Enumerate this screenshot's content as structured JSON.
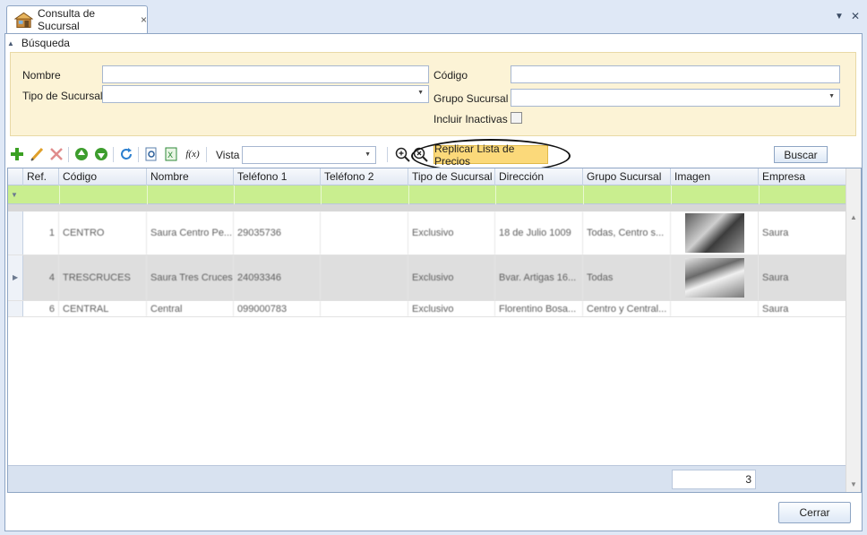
{
  "tab": {
    "title": "Consulta de Sucursal",
    "close_glyph": "×"
  },
  "window_controls": {
    "menu_glyph": "▼",
    "close_glyph": "✕"
  },
  "search": {
    "group_title": "Búsqueda",
    "nombre_label": "Nombre",
    "nombre_value": "",
    "tipo_label": "Tipo de Sucursal",
    "tipo_value": "",
    "codigo_label": "Código",
    "codigo_value": "",
    "grupo_label": "Grupo Sucursal",
    "grupo_value": "",
    "inactivas_label": "Incluir Inactivas",
    "inactivas_checked": false
  },
  "toolbar": {
    "icons": [
      "add-icon",
      "edit-icon",
      "delete-icon",
      "move-up-icon",
      "move-down-icon",
      "refresh-icon",
      "preview-icon",
      "excel-export-icon",
      "formula-icon",
      "zoom-in-icon",
      "zoom-clear-icon"
    ],
    "vista_label": "Vista",
    "vista_value": "",
    "replicar_label": "Replicar Lista de Precios",
    "buscar_label": "Buscar"
  },
  "grid": {
    "columns": [
      "Ref.",
      "Código",
      "Nombre",
      "Teléfono 1",
      "Teléfono 2",
      "Tipo de Sucursal",
      "Dirección",
      "Grupo Sucursal",
      "Imagen",
      "Empresa"
    ],
    "rows": [
      {
        "ref": "1",
        "codigo": "CENTRO",
        "nombre": "Saura Centro Pe...",
        "tel1": "29035736",
        "tel2": "",
        "tipo": "Exclusivo",
        "direccion": "18 de Julio 1009",
        "grupo": "Todas, Centro s...",
        "empresa": "Saura"
      },
      {
        "ref": "4",
        "codigo": "TRESCRUCES",
        "nombre": "Saura Tres Cruces",
        "tel1": "24093346",
        "tel2": "",
        "tipo": "Exclusivo",
        "direccion": "Bvar. Artigas 16...",
        "grupo": "Todas",
        "empresa": "Saura"
      },
      {
        "ref": "6",
        "codigo": "CENTRAL",
        "nombre": "Central",
        "tel1": "099000783",
        "tel2": "",
        "tipo": "Exclusivo",
        "direccion": "Florentino Bosa...",
        "grupo": "Centro y Central...",
        "empresa": "Saura"
      }
    ],
    "record_count": "3"
  },
  "footer": {
    "cerrar_label": "Cerrar"
  },
  "colors": {
    "filter_row": "#c9ee8f",
    "search_panel": "#fcf3d6",
    "highlight_button": "#fbd97a",
    "frame_border": "#8ea5c4"
  }
}
